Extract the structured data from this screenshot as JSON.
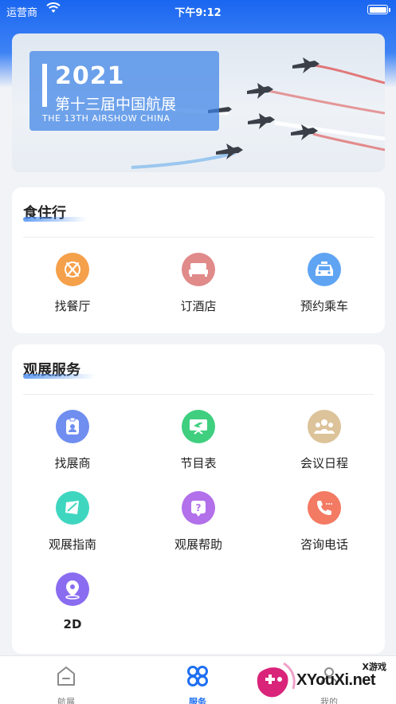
{
  "status_bar": {
    "carrier": "运营商",
    "time": "下午9:12"
  },
  "banner": {
    "year": "2021",
    "title_cn": "第十三届中国航展",
    "title_en": "THE 13TH AIRSHOW CHINA"
  },
  "sections": [
    {
      "title": "食住行",
      "items": [
        {
          "label": "找餐厅",
          "icon": "restaurant-icon",
          "color": "#f5a04a"
        },
        {
          "label": "订酒店",
          "icon": "hotel-bed-icon",
          "color": "#e08a8a"
        },
        {
          "label": "预约乘车",
          "icon": "taxi-icon",
          "color": "#5fa4f3"
        }
      ]
    },
    {
      "title": "观展服务",
      "items": [
        {
          "label": "找展商",
          "icon": "exhibitor-badge-icon",
          "color": "#6f8ef0"
        },
        {
          "label": "节目表",
          "icon": "schedule-board-icon",
          "color": "#3fcf7f"
        },
        {
          "label": "会议日程",
          "icon": "meeting-people-icon",
          "color": "#dcc39a"
        },
        {
          "label": "观展指南",
          "icon": "guide-map-icon",
          "color": "#3fd6c0"
        },
        {
          "label": "观展帮助",
          "icon": "help-question-icon",
          "color": "#b270ea"
        },
        {
          "label": "咨询电话",
          "icon": "phone-call-icon",
          "color": "#f37a63"
        },
        {
          "label": "2D",
          "icon": "location-pin-icon",
          "color": "#8a6cf0"
        }
      ]
    }
  ],
  "tab_bar": {
    "tabs": [
      {
        "label": "航展",
        "icon": "airshow-home-icon",
        "active": false
      },
      {
        "label": "服务",
        "icon": "services-grid-icon",
        "active": true
      },
      {
        "label": "我的",
        "icon": "profile-icon",
        "active": false
      }
    ]
  },
  "watermark": {
    "text": "XYouXi.net",
    "small": "X游戏"
  },
  "colors": {
    "primary": "#1f6ff0",
    "background": "#f1f3f7"
  }
}
